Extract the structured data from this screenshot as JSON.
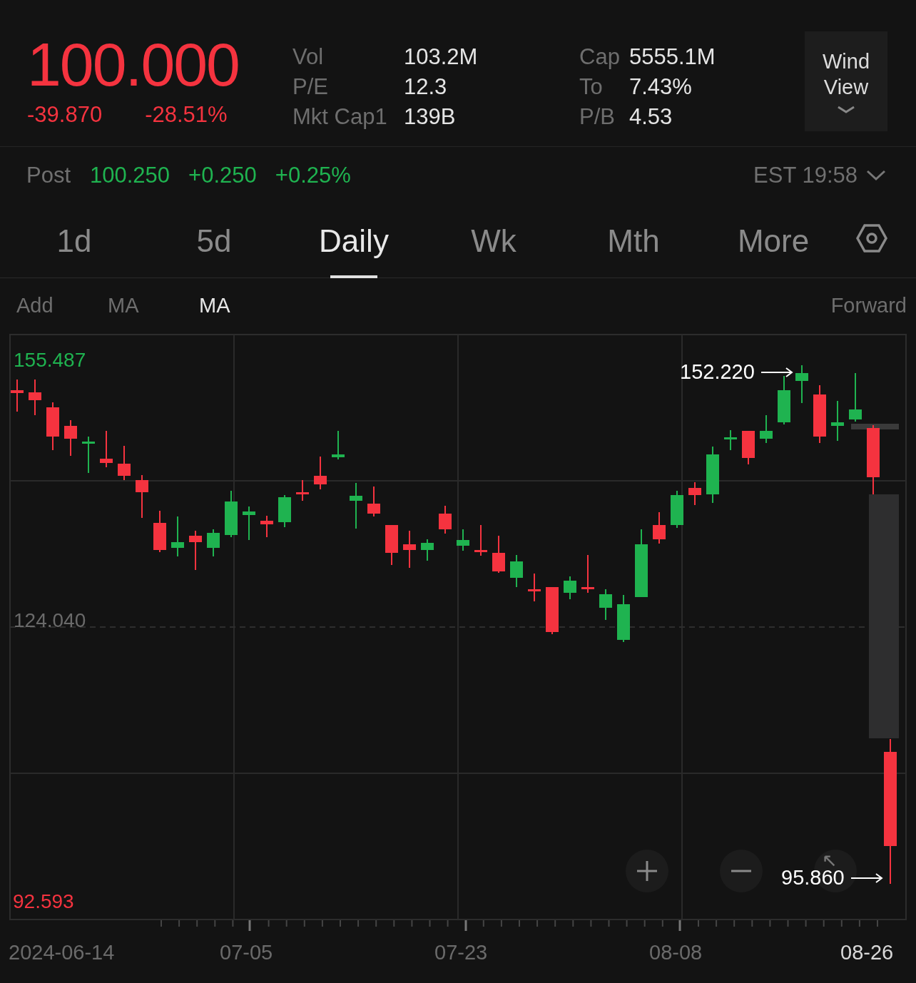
{
  "quote": {
    "price": "100.000",
    "change": "-39.870",
    "change_pct": "-28.51%"
  },
  "stats_left": [
    {
      "label": "Vol",
      "value": "103.2M"
    },
    {
      "label": "P/E",
      "value": "12.3"
    },
    {
      "label": "Mkt Cap1",
      "value": "139B"
    }
  ],
  "stats_right": [
    {
      "label": "Cap",
      "value": "5555.1M"
    },
    {
      "label": "To",
      "value": "7.43%"
    },
    {
      "label": "P/B",
      "value": "4.53"
    }
  ],
  "view_button": {
    "label": "Wind View"
  },
  "post": {
    "label": "Post",
    "price": "100.250",
    "change": "+0.250",
    "change_pct": "+0.25%",
    "time": "EST 19:58"
  },
  "periods": [
    {
      "label": "1d",
      "selected": false
    },
    {
      "label": "5d",
      "selected": false
    },
    {
      "label": "Daily",
      "selected": true
    },
    {
      "label": "Wk",
      "selected": false
    },
    {
      "label": "Mth",
      "selected": false
    },
    {
      "label": "More",
      "selected": false
    }
  ],
  "indicators": [
    {
      "label": "Add",
      "selected": false
    },
    {
      "label": "MA",
      "selected": false
    },
    {
      "label": "MA",
      "selected": true
    }
  ],
  "adjust": "Forward",
  "chart": {
    "high_label": "155.487",
    "mid_label": "124.040",
    "low_label": "92.593",
    "max_marker": "152.220",
    "min_marker": "95.860",
    "dates": [
      {
        "label": "2024-06-14",
        "selected": false
      },
      {
        "label": "07-05",
        "selected": false
      },
      {
        "label": "07-23",
        "selected": false
      },
      {
        "label": "08-08",
        "selected": false
      },
      {
        "label": "08-26",
        "selected": true
      }
    ]
  }
}
